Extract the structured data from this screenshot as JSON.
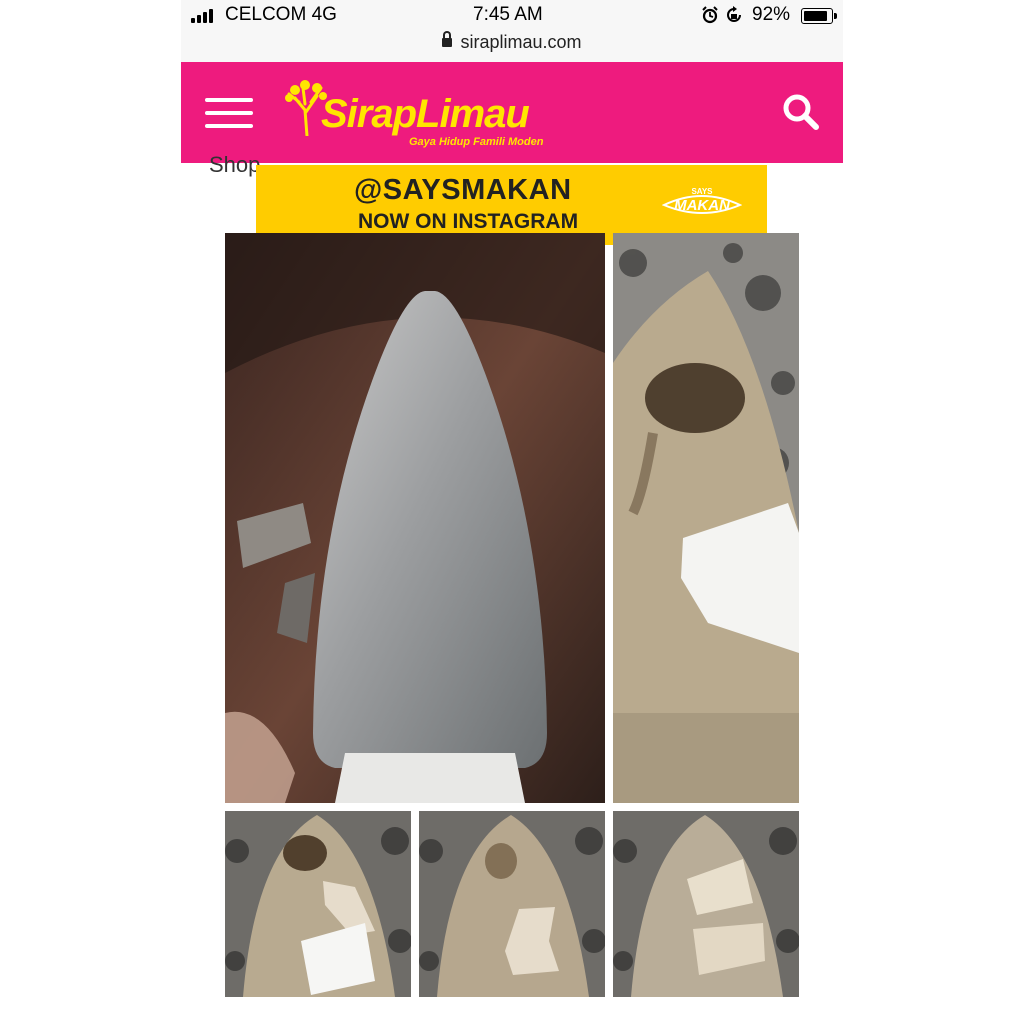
{
  "status_bar": {
    "carrier": "CELCOM 4G",
    "time": "7:45 AM",
    "battery": "92%",
    "url": "siraplimau.com"
  },
  "header": {
    "logo_text": "SirapLimau",
    "tagline": "Gaya Hidup Famili Moden",
    "background_color": "#ee1b7e",
    "logo_color": "#ffe600"
  },
  "content": {
    "partial_text": "Shop"
  },
  "ad_banner": {
    "line1": "@SAYSMAKAN",
    "line2": "NOW ON INSTAGRAM",
    "badge_small": "SAYS",
    "badge": "MAKAN",
    "background_color": "#ffcc00"
  },
  "icons": [
    "signal-icon",
    "lock-icon",
    "alarm-icon",
    "rotation-lock-icon",
    "battery-icon",
    "hamburger-menu-icon",
    "search-icon"
  ]
}
